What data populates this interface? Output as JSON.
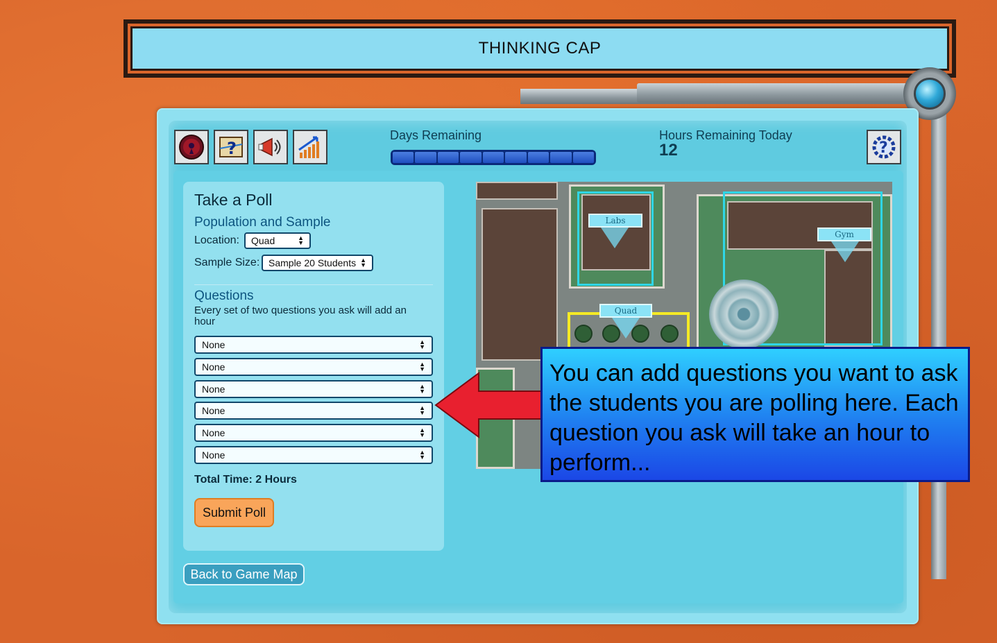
{
  "app": {
    "title": "THINKING CAP"
  },
  "toolbar": {
    "buttons": [
      {
        "name": "record",
        "icon": "record-icon"
      },
      {
        "name": "help-map",
        "icon": "help-map-icon"
      },
      {
        "name": "megaphone",
        "icon": "megaphone-icon"
      },
      {
        "name": "chart",
        "icon": "chart-icon"
      }
    ],
    "help_icon": "gear-help-icon"
  },
  "status": {
    "days_label": "Days Remaining",
    "days_segments": 9,
    "hours_label": "Hours Remaining Today",
    "hours_value": "12"
  },
  "poll": {
    "title": "Take a Poll",
    "population_title": "Population and Sample",
    "location_label": "Location:",
    "location_value": "Quad",
    "sample_label": "Sample Size:",
    "sample_value": "Sample 20 Students",
    "questions_title": "Questions",
    "questions_note": "Every set of two questions you ask will add an hour",
    "questions": [
      "None",
      "None",
      "None",
      "None",
      "None",
      "None"
    ],
    "total_time": "Total Time: 2 Hours",
    "submit_label": "Submit Poll"
  },
  "navigation": {
    "back_label": "Back to Game Map"
  },
  "map": {
    "labels": {
      "labs": "Labs",
      "gym": "Gym",
      "quad": "Quad"
    }
  },
  "tutorial": {
    "callout_text": "You can add questions you want to ask the students you are polling here. Each question you ask will take an hour to perform..."
  },
  "colors": {
    "background": "#d9652b",
    "panel": "#5fcbe0",
    "accent_orange": "#f9a55a",
    "arrow_red": "#e8202f",
    "callout_blue": "#1f7ef0"
  }
}
